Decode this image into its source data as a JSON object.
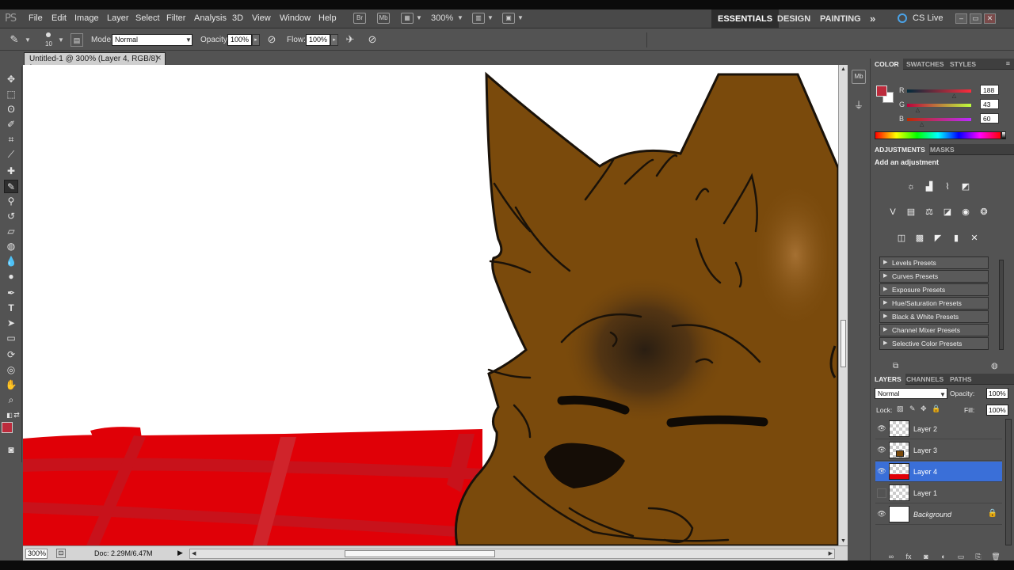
{
  "app": {
    "logo": "PS"
  },
  "menu": [
    "File",
    "Edit",
    "Image",
    "Layer",
    "Select",
    "Filter",
    "Analysis",
    "3D",
    "View",
    "Window",
    "Help"
  ],
  "menubar": {
    "zoom": "300%",
    "mb_label": "Mb",
    "workspaces": [
      "ESSENTIALS",
      "DESIGN",
      "PAINTING"
    ],
    "more": "»",
    "cslive": "CS Live",
    "window_buttons": [
      "–",
      "▭",
      "✕"
    ]
  },
  "options": {
    "brush_size": "10",
    "mode_label": "Mode:",
    "mode_value": "Normal",
    "opacity_label": "Opacity:",
    "opacity_value": "100%",
    "flow_label": "Flow:",
    "flow_value": "100%"
  },
  "document": {
    "tab_title": "Untitled-1 @ 300% (Layer 4, RGB/8) *",
    "close": "✕",
    "status_zoom": "300%",
    "status_doc": "Doc: 2.29M/6.47M"
  },
  "color_panel": {
    "tabs": [
      "COLOR",
      "SWATCHES",
      "STYLES"
    ],
    "channels": [
      {
        "label": "R",
        "value": "188",
        "fraction": 0.737
      },
      {
        "label": "G",
        "value": "43",
        "fraction": 0.169
      },
      {
        "label": "B",
        "value": "60",
        "fraction": 0.235
      }
    ],
    "foreground": "#bc2b3c",
    "background": "#ffffff"
  },
  "adjustments_panel": {
    "tabs": [
      "ADJUSTMENTS",
      "MASKS"
    ],
    "title": "Add an adjustment",
    "icons_row1": [
      "brightness-contrast-icon",
      "levels-icon",
      "curves-icon",
      "exposure-icon"
    ],
    "icons_row2": [
      "vibrance-icon",
      "hue-saturation-icon",
      "color-balance-icon",
      "black-white-icon",
      "photo-filter-icon",
      "channel-mixer-icon"
    ],
    "icons_row3": [
      "invert-icon",
      "posterize-icon",
      "threshold-icon",
      "gradient-map-icon",
      "selective-color-icon"
    ],
    "presets": [
      "Levels Presets",
      "Curves Presets",
      "Exposure Presets",
      "Hue/Saturation Presets",
      "Black & White Presets",
      "Channel Mixer Presets",
      "Selective Color Presets"
    ]
  },
  "layers_panel": {
    "tabs": [
      "LAYERS",
      "CHANNELS",
      "PATHS"
    ],
    "blend_mode": "Normal",
    "opacity_label": "Opacity:",
    "opacity_value": "100%",
    "lock_label": "Lock:",
    "fill_label": "Fill:",
    "fill_value": "100%",
    "layers": [
      {
        "name": "Layer 2",
        "visible": true,
        "selected": false
      },
      {
        "name": "Layer 3",
        "visible": true,
        "selected": false
      },
      {
        "name": "Layer 4",
        "visible": true,
        "selected": true
      },
      {
        "name": "Layer 1",
        "visible": false,
        "selected": false
      },
      {
        "name": "Background",
        "visible": true,
        "selected": false
      }
    ]
  }
}
